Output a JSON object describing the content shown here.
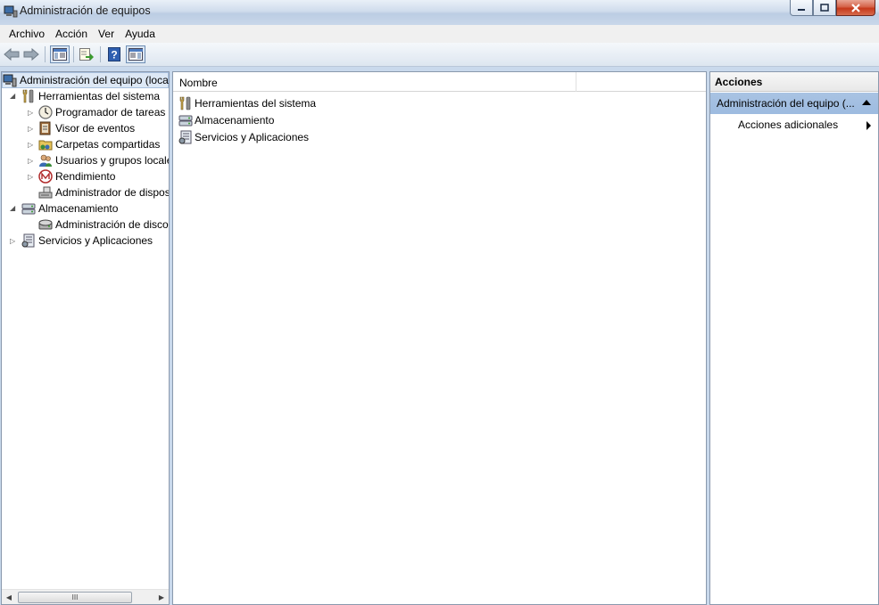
{
  "window": {
    "title": "Administración de equipos"
  },
  "menu": [
    "Archivo",
    "Acción",
    "Ver",
    "Ayuda"
  ],
  "tree": {
    "root": "Administración del equipo (local)",
    "system_tools": "Herramientas del sistema",
    "task_scheduler": "Programador de tareas",
    "event_viewer": "Visor de eventos",
    "shared_folders": "Carpetas compartidas",
    "local_users": "Usuarios y grupos locales",
    "performance": "Rendimiento",
    "device_manager": "Administrador de dispositivos",
    "storage": "Almacenamiento",
    "disk_management": "Administración de discos",
    "services": "Servicios y Aplicaciones",
    "scrollbar_grip": "III"
  },
  "list": {
    "column_name": "Nombre",
    "items": [
      "Herramientas del sistema",
      "Almacenamiento",
      "Servicios y Aplicaciones"
    ]
  },
  "actions": {
    "header": "Acciones",
    "section": "Administración del equipo (...",
    "more": "Acciones adicionales"
  },
  "icons": [
    "back-arrow-icon",
    "forward-arrow-icon",
    "show-hide-tree-icon",
    "export-list-icon",
    "help-icon",
    "action-pane-icon",
    "computer-icon",
    "tools-icon",
    "clock-icon",
    "event-viewer-icon",
    "shared-folder-icon",
    "users-icon",
    "performance-icon",
    "device-manager-icon",
    "storage-icon",
    "disk-icon",
    "services-icon"
  ]
}
